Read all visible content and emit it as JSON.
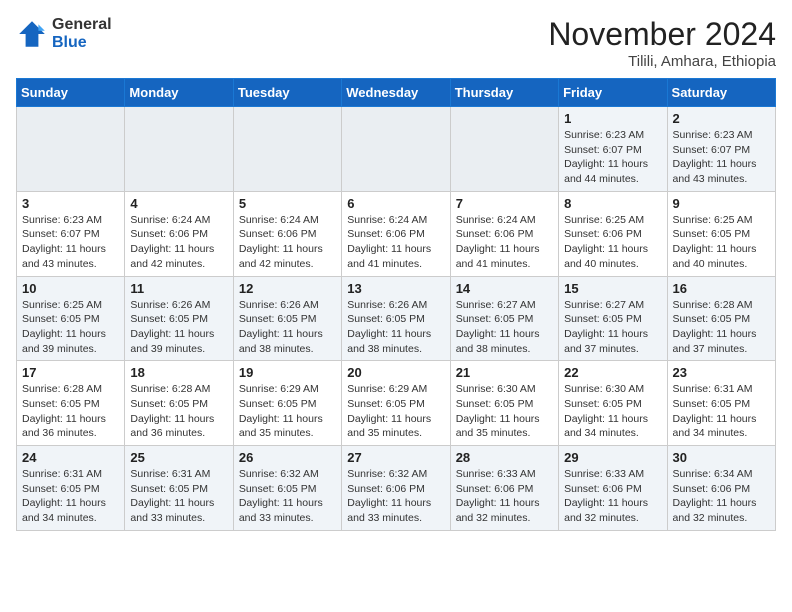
{
  "header": {
    "logo_line1": "General",
    "logo_line2": "Blue",
    "month": "November 2024",
    "location": "Tilili, Amhara, Ethiopia"
  },
  "weekdays": [
    "Sunday",
    "Monday",
    "Tuesday",
    "Wednesday",
    "Thursday",
    "Friday",
    "Saturday"
  ],
  "weeks": [
    [
      {
        "day": "",
        "info": ""
      },
      {
        "day": "",
        "info": ""
      },
      {
        "day": "",
        "info": ""
      },
      {
        "day": "",
        "info": ""
      },
      {
        "day": "",
        "info": ""
      },
      {
        "day": "1",
        "info": "Sunrise: 6:23 AM\nSunset: 6:07 PM\nDaylight: 11 hours\nand 44 minutes."
      },
      {
        "day": "2",
        "info": "Sunrise: 6:23 AM\nSunset: 6:07 PM\nDaylight: 11 hours\nand 43 minutes."
      }
    ],
    [
      {
        "day": "3",
        "info": "Sunrise: 6:23 AM\nSunset: 6:07 PM\nDaylight: 11 hours\nand 43 minutes."
      },
      {
        "day": "4",
        "info": "Sunrise: 6:24 AM\nSunset: 6:06 PM\nDaylight: 11 hours\nand 42 minutes."
      },
      {
        "day": "5",
        "info": "Sunrise: 6:24 AM\nSunset: 6:06 PM\nDaylight: 11 hours\nand 42 minutes."
      },
      {
        "day": "6",
        "info": "Sunrise: 6:24 AM\nSunset: 6:06 PM\nDaylight: 11 hours\nand 41 minutes."
      },
      {
        "day": "7",
        "info": "Sunrise: 6:24 AM\nSunset: 6:06 PM\nDaylight: 11 hours\nand 41 minutes."
      },
      {
        "day": "8",
        "info": "Sunrise: 6:25 AM\nSunset: 6:06 PM\nDaylight: 11 hours\nand 40 minutes."
      },
      {
        "day": "9",
        "info": "Sunrise: 6:25 AM\nSunset: 6:05 PM\nDaylight: 11 hours\nand 40 minutes."
      }
    ],
    [
      {
        "day": "10",
        "info": "Sunrise: 6:25 AM\nSunset: 6:05 PM\nDaylight: 11 hours\nand 39 minutes."
      },
      {
        "day": "11",
        "info": "Sunrise: 6:26 AM\nSunset: 6:05 PM\nDaylight: 11 hours\nand 39 minutes."
      },
      {
        "day": "12",
        "info": "Sunrise: 6:26 AM\nSunset: 6:05 PM\nDaylight: 11 hours\nand 38 minutes."
      },
      {
        "day": "13",
        "info": "Sunrise: 6:26 AM\nSunset: 6:05 PM\nDaylight: 11 hours\nand 38 minutes."
      },
      {
        "day": "14",
        "info": "Sunrise: 6:27 AM\nSunset: 6:05 PM\nDaylight: 11 hours\nand 38 minutes."
      },
      {
        "day": "15",
        "info": "Sunrise: 6:27 AM\nSunset: 6:05 PM\nDaylight: 11 hours\nand 37 minutes."
      },
      {
        "day": "16",
        "info": "Sunrise: 6:28 AM\nSunset: 6:05 PM\nDaylight: 11 hours\nand 37 minutes."
      }
    ],
    [
      {
        "day": "17",
        "info": "Sunrise: 6:28 AM\nSunset: 6:05 PM\nDaylight: 11 hours\nand 36 minutes."
      },
      {
        "day": "18",
        "info": "Sunrise: 6:28 AM\nSunset: 6:05 PM\nDaylight: 11 hours\nand 36 minutes."
      },
      {
        "day": "19",
        "info": "Sunrise: 6:29 AM\nSunset: 6:05 PM\nDaylight: 11 hours\nand 35 minutes."
      },
      {
        "day": "20",
        "info": "Sunrise: 6:29 AM\nSunset: 6:05 PM\nDaylight: 11 hours\nand 35 minutes."
      },
      {
        "day": "21",
        "info": "Sunrise: 6:30 AM\nSunset: 6:05 PM\nDaylight: 11 hours\nand 35 minutes."
      },
      {
        "day": "22",
        "info": "Sunrise: 6:30 AM\nSunset: 6:05 PM\nDaylight: 11 hours\nand 34 minutes."
      },
      {
        "day": "23",
        "info": "Sunrise: 6:31 AM\nSunset: 6:05 PM\nDaylight: 11 hours\nand 34 minutes."
      }
    ],
    [
      {
        "day": "24",
        "info": "Sunrise: 6:31 AM\nSunset: 6:05 PM\nDaylight: 11 hours\nand 34 minutes."
      },
      {
        "day": "25",
        "info": "Sunrise: 6:31 AM\nSunset: 6:05 PM\nDaylight: 11 hours\nand 33 minutes."
      },
      {
        "day": "26",
        "info": "Sunrise: 6:32 AM\nSunset: 6:05 PM\nDaylight: 11 hours\nand 33 minutes."
      },
      {
        "day": "27",
        "info": "Sunrise: 6:32 AM\nSunset: 6:06 PM\nDaylight: 11 hours\nand 33 minutes."
      },
      {
        "day": "28",
        "info": "Sunrise: 6:33 AM\nSunset: 6:06 PM\nDaylight: 11 hours\nand 32 minutes."
      },
      {
        "day": "29",
        "info": "Sunrise: 6:33 AM\nSunset: 6:06 PM\nDaylight: 11 hours\nand 32 minutes."
      },
      {
        "day": "30",
        "info": "Sunrise: 6:34 AM\nSunset: 6:06 PM\nDaylight: 11 hours\nand 32 minutes."
      }
    ]
  ]
}
